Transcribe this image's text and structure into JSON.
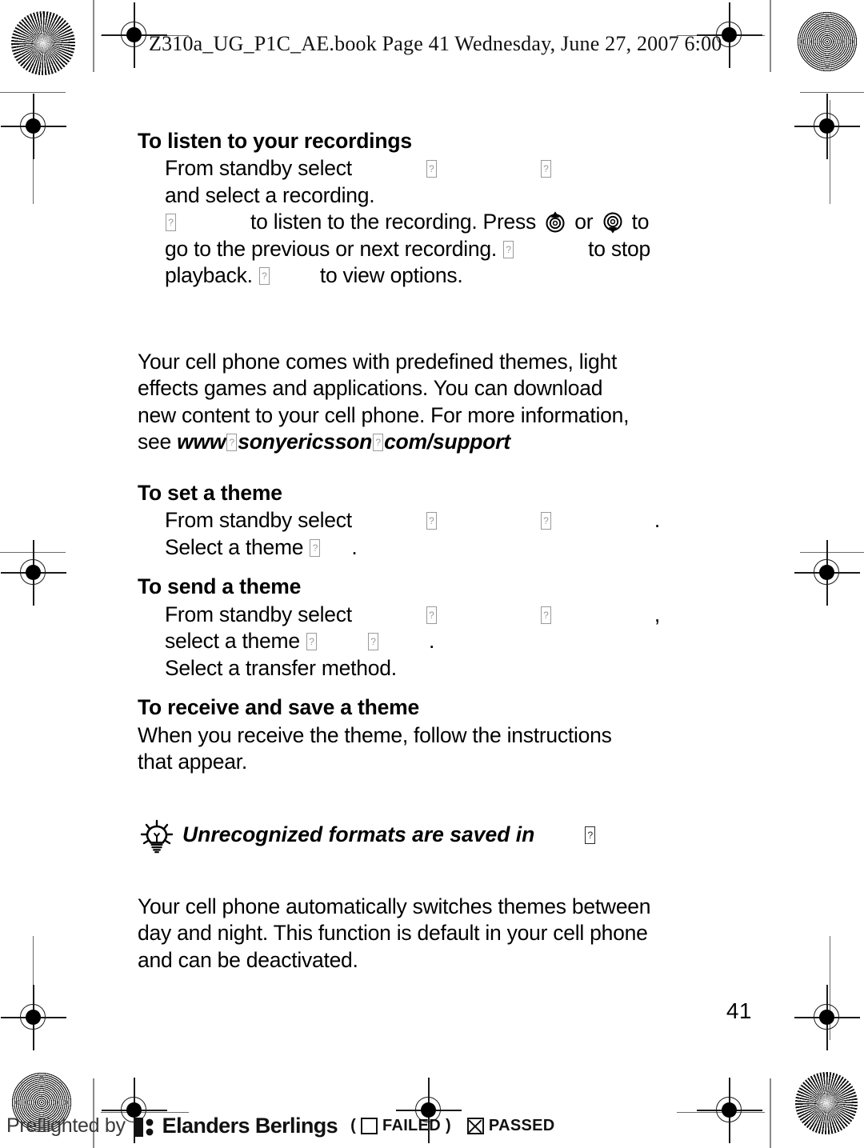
{
  "document": {
    "running_head": "Z310a_UG_P1C_AE.book  Page 41  Wednesday, June 27, 2007  6:00",
    "page_number": "41"
  },
  "sections": [
    {
      "id": "listen-recordings",
      "heading": "To listen to your recordings",
      "lines": [
        {
          "parts": [
            {
              "t": "text",
              "v": "From standby select"
            },
            {
              "t": "space",
              "v": "wide"
            },
            {
              "t": "tofu"
            },
            {
              "t": "space",
              "v": "xwide"
            },
            {
              "t": "tofu"
            }
          ]
        },
        {
          "parts": [
            {
              "t": "text",
              "v": "and select a recording."
            }
          ]
        },
        {
          "parts": [
            {
              "t": "tofu"
            },
            {
              "t": "space",
              "v": "wide"
            },
            {
              "t": "text",
              "v": "to listen to the recording. Press"
            },
            {
              "t": "navkey",
              "v": "nav-key-up-icon"
            },
            {
              "t": "text",
              "v": "or"
            },
            {
              "t": "navkey",
              "v": "nav-key-down-icon"
            },
            {
              "t": "text",
              "v": "to"
            }
          ]
        },
        {
          "parts": [
            {
              "t": "text",
              "v": "go to the previous or next recording."
            },
            {
              "t": "tofu"
            },
            {
              "t": "space",
              "v": "wide"
            },
            {
              "t": "text",
              "v": "to stop"
            }
          ]
        },
        {
          "parts": [
            {
              "t": "text",
              "v": "playback."
            },
            {
              "t": "tofu"
            },
            {
              "t": "space",
              "v": "wide"
            },
            {
              "t": "text",
              "v": "to view options."
            }
          ]
        }
      ]
    }
  ],
  "themes_intro": {
    "lines": [
      "Your cell phone comes with predefined themes, light",
      "effects games and applications. You can download",
      "new content to your cell phone. For more information,"
    ],
    "see_label": "see",
    "url_part_1": "www",
    "url_part_2": "sonyericsson",
    "url_part_3": "com/support"
  },
  "set_theme": {
    "heading": "To set a theme",
    "line1_prefix": "From standby select",
    "line1_suffix": ".",
    "line2_prefix": "Select a theme",
    "line2_suffix": "."
  },
  "send_theme": {
    "heading": "To send a theme",
    "line1_prefix": "From standby select",
    "line1_suffix": ",",
    "line2_prefix": "select a theme",
    "line2_suffix": ".",
    "line3": "Select a transfer method."
  },
  "receive_theme": {
    "heading": "To receive and save a theme",
    "line1": "When you receive the theme, follow the instructions",
    "line2": "that appear."
  },
  "tip": {
    "icon": "lightbulb-tip-icon",
    "text": "Unrecognized formats are saved in"
  },
  "auto_theme": {
    "lines": [
      "Your cell phone automatically switches themes between",
      "day and night. This function is default in your cell phone",
      "and can be deactivated."
    ]
  },
  "footer": {
    "preflight_label": "Preflighted by",
    "logo": "elanders-logo-icon",
    "brand": "Elanders Berlings",
    "open_paren": "(",
    "failed_label": "FAILED",
    "close_paren": ")",
    "passed_label": "PASSED"
  },
  "marks": {
    "starburst": "starburst-registration-mark",
    "moire": "moire-registration-mark",
    "target": "crosshair-registration-target"
  }
}
